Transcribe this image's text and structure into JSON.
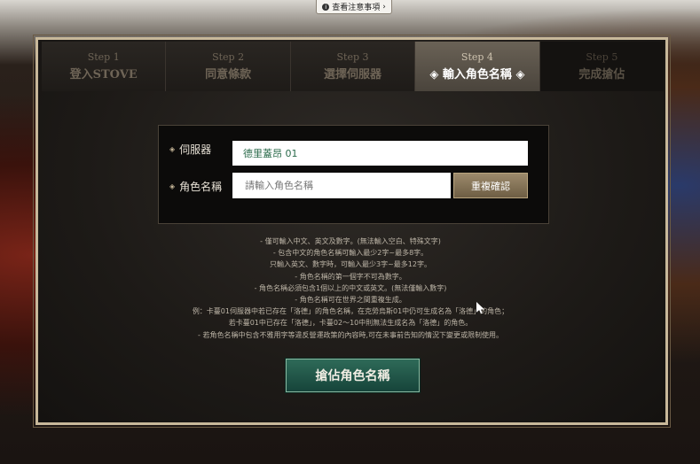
{
  "top_notice": {
    "label": "查看注意事項",
    "icon": "info-icon"
  },
  "steps": [
    {
      "num": "Step 1",
      "label": "登入STOVE",
      "state": "pending"
    },
    {
      "num": "Step 2",
      "label": "同意條款",
      "state": "pending"
    },
    {
      "num": "Step 3",
      "label": "選擇伺服器",
      "state": "pending"
    },
    {
      "num": "Step 4",
      "label": "◈ 輸入角色名稱 ◈",
      "state": "active"
    },
    {
      "num": "Step 5",
      "label": "完成搶佔",
      "state": "disabled"
    }
  ],
  "form": {
    "server_label": "伺服器",
    "server_value": "德里蓋昂 01",
    "name_label": "角色名稱",
    "name_placeholder": "請輸入角色名稱",
    "check_button": "重複確認"
  },
  "notes": [
    "- 僅可輸入中文、英文及數字。(無法輸入空白、特殊文字)",
    "- 包含中文的角色名稱可輸入最少2字~最多8字。",
    "只輸入英文、數字時，可輸入最少3字~最多12字。",
    "- 角色名稱的第一個字不可為數字。",
    "- 角色名稱必須包含1個以上的中文或英文。(無法僅輸入數字)",
    "- 角色名稱可在世界之間重複生成。",
    "例：卡蔓01伺服器中若已存在「洛德」的角色名稱，在克勞烏斯01中仍可生成名為「洛德」的角色；",
    "若卡蔓01中已存在「洛德」，卡蔓02～10中則無法生成名為「洛德」的角色。",
    "- 若角色名稱中包含不雅用字等違反營運政策的內容時,可在未事前告知的情況下變更或限制使用。"
  ],
  "main_button": "搶佔角色名稱",
  "colors": {
    "accent_green": "#1f5a4a",
    "gold_border": "#c8b89a",
    "active_step": "#5a5248"
  }
}
